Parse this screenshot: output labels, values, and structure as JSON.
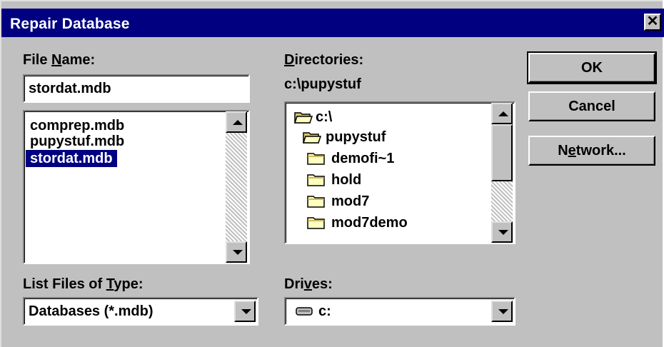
{
  "window": {
    "title": "Repair Database",
    "close_glyph": "✕"
  },
  "file_name": {
    "label_pre": "File ",
    "label_key": "N",
    "label_post": "ame:",
    "value": "stordat.mdb",
    "files": [
      "comprep.mdb",
      "pupystuf.mdb",
      "stordat.mdb"
    ],
    "selected": "stordat.mdb"
  },
  "directories": {
    "label_key": "D",
    "label_post": "irectories:",
    "current_path": "c:\\pupystuf",
    "items": [
      {
        "name": "c:\\",
        "icon": "open-folder-icon"
      },
      {
        "name": "pupystuf",
        "icon": "open-folder-icon"
      },
      {
        "name": "demofi~1",
        "icon": "folder-icon"
      },
      {
        "name": "hold",
        "icon": "folder-icon"
      },
      {
        "name": "mod7",
        "icon": "folder-icon"
      },
      {
        "name": "mod7demo",
        "icon": "folder-icon"
      }
    ]
  },
  "buttons": {
    "ok": "OK",
    "cancel": "Cancel",
    "network_pre": "N",
    "network_key": "e",
    "network_post": "twork..."
  },
  "file_type": {
    "label_pre": "List Files of ",
    "label_key": "T",
    "label_post": "ype:",
    "value": "Databases (*.mdb)"
  },
  "drives": {
    "label_pre": "Dri",
    "label_key": "v",
    "label_post": "es:",
    "value": "c:",
    "icon": "drive-icon"
  },
  "colors": {
    "titlebar": "#000080",
    "face": "#c0c0c0",
    "selection": "#000080"
  }
}
